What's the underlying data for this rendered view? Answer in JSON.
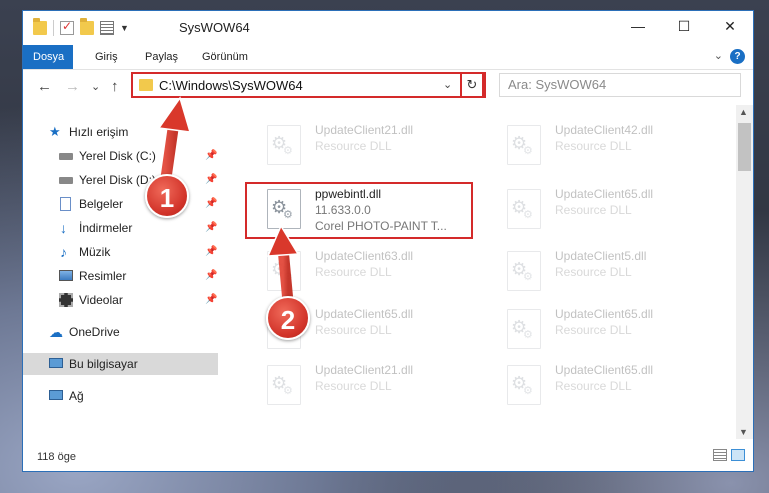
{
  "window": {
    "title": "SysWOW64",
    "controls": {
      "minimize": "—",
      "maximize": "☐",
      "close": "✕"
    }
  },
  "ribbon": {
    "tabs": [
      "Dosya",
      "Giriş",
      "Paylaş",
      "Görünüm"
    ],
    "help": "?",
    "collapse": "⌄"
  },
  "toolbar": {
    "back": "←",
    "forward": "→",
    "recent": "⌄",
    "up": "↑",
    "address": "C:\\Windows\\SysWOW64",
    "address_drop": "⌄",
    "refresh": "↻",
    "search_placeholder": "Ara: SysWOW64"
  },
  "nav": {
    "items": [
      {
        "label": "Hızlı erişim",
        "icon": "star-icon",
        "pinned": false
      },
      {
        "label": "Yerel Disk (C:)",
        "icon": "drive-icon",
        "pinned": true
      },
      {
        "label": "Yerel Disk (D:)",
        "icon": "drive-icon",
        "pinned": true
      },
      {
        "label": "Belgeler",
        "icon": "documents-icon",
        "pinned": true
      },
      {
        "label": "İndirmeler",
        "icon": "downloads-icon",
        "pinned": true
      },
      {
        "label": "Müzik",
        "icon": "music-icon",
        "pinned": true
      },
      {
        "label": "Resimler",
        "icon": "pictures-icon",
        "pinned": true
      },
      {
        "label": "Videolar",
        "icon": "videos-icon",
        "pinned": true
      },
      {
        "label": "OneDrive",
        "icon": "cloud-icon",
        "pinned": false
      },
      {
        "label": "Bu bilgisayar",
        "icon": "computer-icon",
        "pinned": false
      },
      {
        "label": "Ağ",
        "icon": "network-icon",
        "pinned": false
      }
    ],
    "pin_glyph": "📌"
  },
  "files": {
    "highlighted": {
      "name": "ppwebintl.dll",
      "version": "11.633.0.0",
      "desc": "Corel PHOTO-PAINT T..."
    },
    "ghosts": [
      {
        "name": "UpdateClient21.dll",
        "desc": "Resource DLL"
      },
      {
        "name": "UpdateClient42.dll",
        "desc": "Resource DLL"
      },
      {
        "name": "UpdateClient65.dll",
        "desc": "Resource DLL"
      },
      {
        "name": "UpdateClient63.dll",
        "desc": "Resource DLL"
      },
      {
        "name": "UpdateClient5.dll",
        "desc": "Resource DLL"
      },
      {
        "name": "UpdateClient65.dll",
        "desc": "Resource DLL"
      },
      {
        "name": "UpdateClient65.dll",
        "desc": "Resource DLL"
      },
      {
        "name": "UpdateClient21.dll",
        "desc": "Resource DLL"
      },
      {
        "name": "UpdateClient65.dll",
        "desc": "Resource DLL"
      }
    ]
  },
  "status": {
    "count": "118 öge"
  },
  "annotations": {
    "step1": "1",
    "step2": "2"
  },
  "colors": {
    "accent": "#1a6fc4",
    "highlight": "#d42a2a"
  }
}
